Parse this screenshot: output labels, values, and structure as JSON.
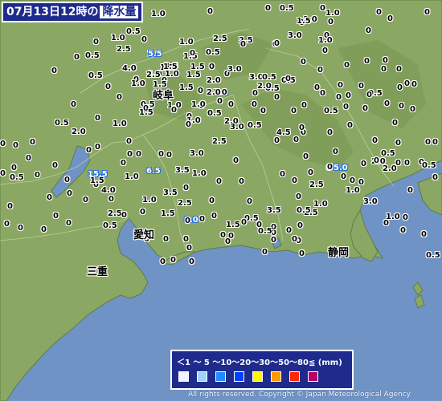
{
  "title": {
    "datetime": "07月13日12時の",
    "variable": "降水量"
  },
  "prefectures": [
    {
      "name": "岐阜",
      "id": "gifu"
    },
    {
      "name": "愛知",
      "id": "aichi"
    },
    {
      "name": "三重",
      "id": "mie"
    },
    {
      "name": "静岡",
      "id": "shizuoka"
    }
  ],
  "observations": [
    {
      "value": "1.0"
    },
    {
      "value": "0"
    },
    {
      "value": "0"
    },
    {
      "value": "0"
    },
    {
      "value": "0"
    },
    {
      "value": "0"
    },
    {
      "value": "0.5"
    },
    {
      "value": "0"
    },
    {
      "value": "0"
    },
    {
      "value": "1.0"
    },
    {
      "value": "1.0"
    },
    {
      "value": "0"
    },
    {
      "value": "1.5"
    },
    {
      "value": "3.0"
    },
    {
      "value": "0"
    },
    {
      "value": "0"
    },
    {
      "value": "0.5"
    },
    {
      "value": "1.0"
    },
    {
      "value": "0.5"
    },
    {
      "value": "0"
    },
    {
      "value": "1.0"
    },
    {
      "value": "2.5"
    },
    {
      "value": "2.5"
    },
    {
      "value": "1.5"
    },
    {
      "value": "0"
    },
    {
      "value": "0"
    },
    {
      "value": "1.0"
    },
    {
      "value": "1.0"
    },
    {
      "value": "0"
    },
    {
      "value": "1.5"
    },
    {
      "value": "0"
    },
    {
      "value": "0"
    },
    {
      "value": "0.5"
    },
    {
      "value": "2.5"
    },
    {
      "value": "5.5"
    },
    {
      "value": "1.5"
    },
    {
      "value": "1.5"
    },
    {
      "value": "0.5"
    },
    {
      "value": "0"
    },
    {
      "value": "0"
    },
    {
      "value": "0"
    },
    {
      "value": "0"
    },
    {
      "value": "0"
    },
    {
      "value": "0"
    },
    {
      "value": "1.0"
    },
    {
      "value": "3.5"
    },
    {
      "value": "0"
    },
    {
      "value": "0"
    },
    {
      "value": "0"
    },
    {
      "value": "0"
    },
    {
      "value": "0"
    },
    {
      "value": "4.0"
    },
    {
      "value": "1.5"
    },
    {
      "value": "1.0"
    },
    {
      "value": "3.0"
    },
    {
      "value": "0.5"
    },
    {
      "value": "0.5"
    },
    {
      "value": "0"
    },
    {
      "value": "0"
    },
    {
      "value": "0"
    },
    {
      "value": "0"
    },
    {
      "value": "1.5"
    },
    {
      "value": "2.5"
    },
    {
      "value": "2.0"
    },
    {
      "value": "0"
    },
    {
      "value": "0"
    },
    {
      "value": "0"
    },
    {
      "value": "1.0"
    },
    {
      "value": "3.0"
    },
    {
      "value": "1.5"
    },
    {
      "value": "5.0"
    },
    {
      "value": "0"
    },
    {
      "value": "0"
    },
    {
      "value": "0"
    },
    {
      "value": "0"
    },
    {
      "value": "0"
    },
    {
      "value": "0"
    },
    {
      "value": "0.5"
    },
    {
      "value": "0"
    },
    {
      "value": "0"
    },
    {
      "value": "1.0"
    },
    {
      "value": "0.5"
    },
    {
      "value": "2.0"
    },
    {
      "value": "0"
    },
    {
      "value": "0"
    },
    {
      "value": "0"
    },
    {
      "value": "0"
    },
    {
      "value": "0"
    },
    {
      "value": "1.5"
    },
    {
      "value": "0"
    },
    {
      "value": "1.0"
    },
    {
      "value": "2.0"
    },
    {
      "value": "0"
    },
    {
      "value": "0"
    },
    {
      "value": "0"
    },
    {
      "value": "0"
    },
    {
      "value": "0.5"
    },
    {
      "value": "1.0"
    },
    {
      "value": "0"
    },
    {
      "value": "2.0"
    },
    {
      "value": "2.0"
    },
    {
      "value": "0.5"
    },
    {
      "value": "0"
    },
    {
      "value": "0"
    },
    {
      "value": "0"
    },
    {
      "value": "0.5"
    },
    {
      "value": "0"
    },
    {
      "value": "1.0"
    },
    {
      "value": "0"
    },
    {
      "value": "3.0"
    },
    {
      "value": "0"
    },
    {
      "value": "0"
    },
    {
      "value": "0"
    },
    {
      "value": "0"
    },
    {
      "value": "0"
    },
    {
      "value": "0"
    },
    {
      "value": "0"
    },
    {
      "value": "0"
    },
    {
      "value": "0"
    },
    {
      "value": "0"
    },
    {
      "value": "0"
    },
    {
      "value": "0"
    },
    {
      "value": "0.5"
    },
    {
      "value": "2.0"
    },
    {
      "value": "0.5"
    },
    {
      "value": "4.5"
    },
    {
      "value": "0"
    },
    {
      "value": "0"
    },
    {
      "value": "0"
    },
    {
      "value": "0"
    },
    {
      "value": "0"
    },
    {
      "value": "2.5"
    },
    {
      "value": "0"
    },
    {
      "value": "0"
    },
    {
      "value": "0"
    },
    {
      "value": "0"
    },
    {
      "value": "0.5"
    },
    {
      "value": "2.0"
    },
    {
      "value": "0"
    },
    {
      "value": "0"
    },
    {
      "value": "0"
    },
    {
      "value": "0"
    },
    {
      "value": "0"
    },
    {
      "value": "0"
    },
    {
      "value": "15.5"
    },
    {
      "value": "0"
    },
    {
      "value": "0"
    },
    {
      "value": "0"
    },
    {
      "value": "0"
    },
    {
      "value": "0"
    },
    {
      "value": "0"
    },
    {
      "value": "0"
    },
    {
      "value": "0"
    },
    {
      "value": "0.5"
    },
    {
      "value": "2.0"
    },
    {
      "value": "5.0"
    },
    {
      "value": "0"
    },
    {
      "value": "0"
    },
    {
      "value": "0"
    },
    {
      "value": "0"
    },
    {
      "value": "0"
    },
    {
      "value": "0"
    },
    {
      "value": "1.0"
    },
    {
      "value": "6.5"
    },
    {
      "value": "3.5"
    },
    {
      "value": "3.0"
    },
    {
      "value": "1.0"
    },
    {
      "value": "0"
    },
    {
      "value": "0"
    },
    {
      "value": "0"
    },
    {
      "value": "0"
    },
    {
      "value": "0"
    },
    {
      "value": "0.5"
    },
    {
      "value": "0"
    },
    {
      "value": "0"
    },
    {
      "value": "4.0"
    },
    {
      "value": "2.5"
    },
    {
      "value": "1.5"
    },
    {
      "value": "0"
    },
    {
      "value": "0"
    },
    {
      "value": "0"
    },
    {
      "value": "0"
    },
    {
      "value": "0"
    },
    {
      "value": "0"
    },
    {
      "value": "0"
    },
    {
      "value": "3.0"
    },
    {
      "value": "1.0"
    },
    {
      "value": "0"
    },
    {
      "value": "0"
    },
    {
      "value": "0"
    },
    {
      "value": "0"
    },
    {
      "value": "0"
    },
    {
      "value": "0"
    },
    {
      "value": "1.0"
    },
    {
      "value": "3.5"
    },
    {
      "value": "2.5"
    },
    {
      "value": "2.5"
    },
    {
      "value": "1.0"
    },
    {
      "value": "0"
    },
    {
      "value": "0"
    },
    {
      "value": "0"
    },
    {
      "value": "0"
    },
    {
      "value": "2.5"
    },
    {
      "value": "3.5"
    },
    {
      "value": "8.0"
    },
    {
      "value": "0"
    },
    {
      "value": "0"
    },
    {
      "value": "0"
    },
    {
      "value": "0"
    },
    {
      "value": "0.5"
    },
    {
      "value": "1.5"
    },
    {
      "value": "0"
    },
    {
      "value": "1.5"
    },
    {
      "value": "0.5"
    },
    {
      "value": "0.5"
    },
    {
      "value": "1.0"
    },
    {
      "value": "0"
    },
    {
      "value": "0"
    },
    {
      "value": "0"
    },
    {
      "value": "0"
    },
    {
      "value": "0"
    },
    {
      "value": "0"
    },
    {
      "value": "0"
    },
    {
      "value": "0"
    },
    {
      "value": "0"
    },
    {
      "value": "0"
    },
    {
      "value": "0"
    },
    {
      "value": "0"
    },
    {
      "value": "0.5"
    },
    {
      "value": "0"
    },
    {
      "value": "0"
    },
    {
      "value": "0"
    },
    {
      "value": "0"
    },
    {
      "value": "0"
    },
    {
      "value": "0"
    },
    {
      "value": "0"
    },
    {
      "value": "0"
    },
    {
      "value": "0"
    },
    {
      "value": "0"
    },
    {
      "value": "0"
    },
    {
      "value": "0"
    },
    {
      "value": "0"
    },
    {
      "value": "0"
    },
    {
      "value": "0"
    },
    {
      "value": "0"
    },
    {
      "value": "0"
    },
    {
      "value": "0.5"
    },
    {
      "value": "0"
    },
    {
      "value": "1.0"
    },
    {
      "value": "0"
    },
    {
      "value": "0"
    },
    {
      "value": "0"
    },
    {
      "value": "0"
    },
    {
      "value": "1.0"
    }
  ],
  "legend": {
    "scale_text": "＜1 〜 5 〜10〜20〜30〜50〜80≦ (mm)",
    "colors": [
      "#f2f2ff",
      "#a0d2ff",
      "#218cff",
      "#0041ff",
      "#fff500",
      "#ff9900",
      "#ff2800",
      "#b40068"
    ]
  },
  "copyright": "All rights reserved. Copyright © Japan Meteorological Agency",
  "colors": {
    "sea": "#6f93c4",
    "land": "#8aa863",
    "title_bg": "#1e2a8c"
  }
}
